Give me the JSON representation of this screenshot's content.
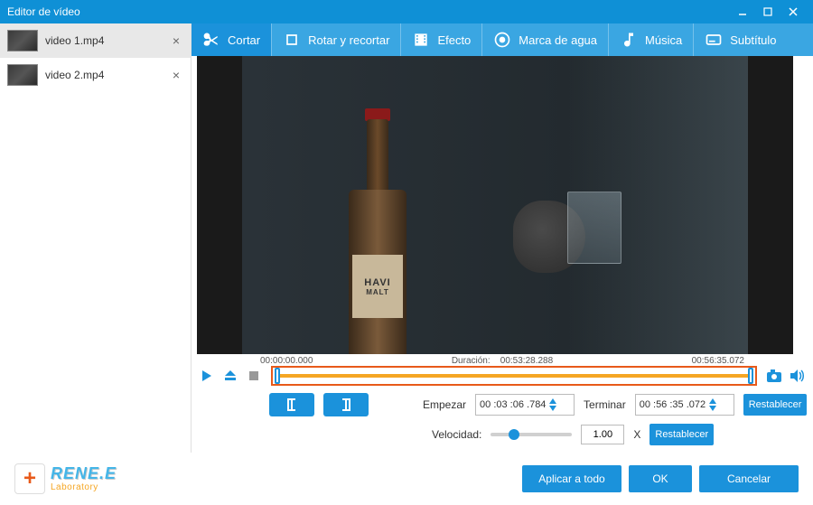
{
  "window": {
    "title": "Editor de vídeo"
  },
  "sidebar": {
    "items": [
      {
        "name": "video 1.mp4",
        "selected": true
      },
      {
        "name": "video 2.mp4",
        "selected": false
      }
    ]
  },
  "toolbar": {
    "cut": "Cortar",
    "rotate": "Rotar y recortar",
    "effect": "Efecto",
    "watermark": "Marca de agua",
    "music": "Música",
    "subtitle": "Subtítulo"
  },
  "preview": {
    "bottle_label_line1": "HAVI",
    "bottle_label_line2": "MALT"
  },
  "timeline": {
    "start_time": "00:00:00.000",
    "duration_label": "Duración:",
    "duration_value": "00:53:28.288",
    "end_time": "00:56:35.072"
  },
  "params": {
    "start_label": "Empezar",
    "start_value": "00 :03 :06 .784",
    "end_label": "Terminar",
    "end_value": "00 :56 :35 .072",
    "reset": "Restablecer",
    "speed_label": "Velocidad:",
    "speed_value": "1.00",
    "speed_suffix": "X",
    "speed_percent": 22
  },
  "footer": {
    "brand_name": "RENE.E",
    "brand_sub": "Laboratory",
    "apply_all": "Aplicar a todo",
    "ok": "OK",
    "cancel": "Cancelar"
  }
}
